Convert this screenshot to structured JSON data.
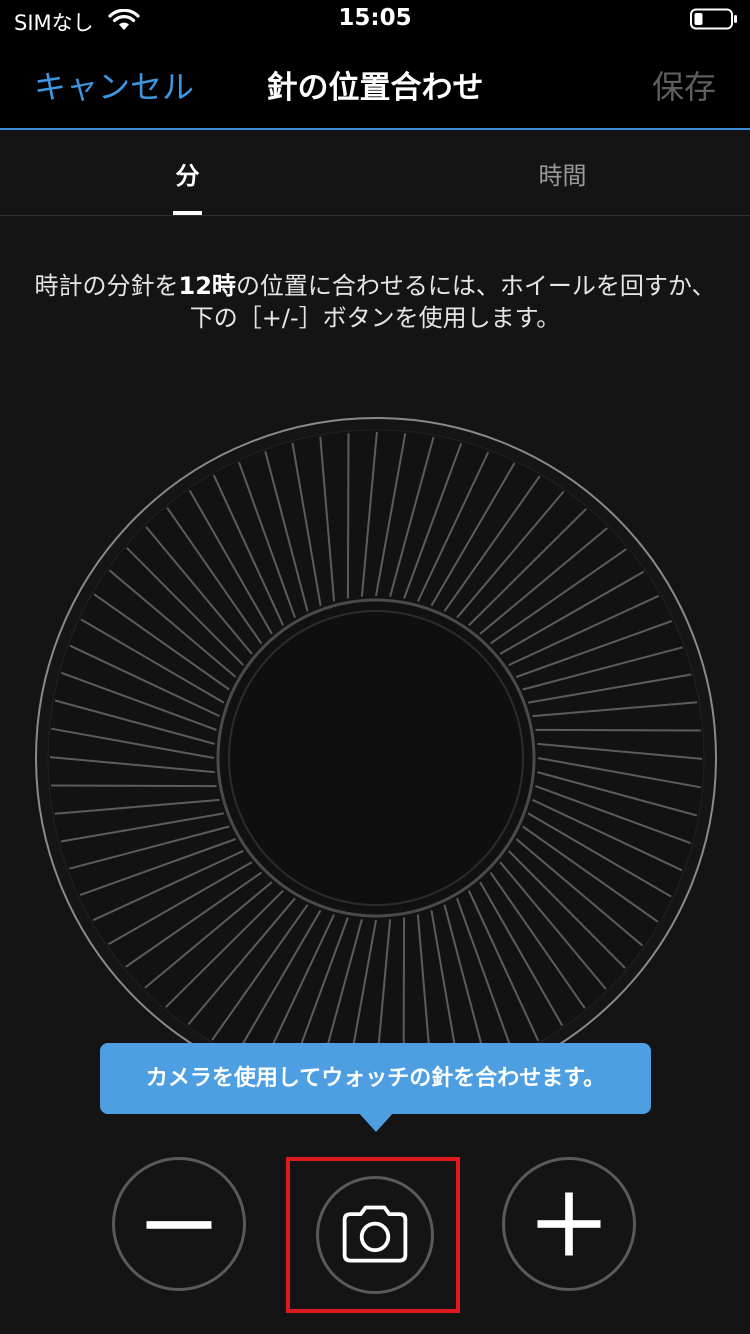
{
  "status_bar": {
    "carrier": "SIMなし",
    "time": "15:05"
  },
  "nav": {
    "cancel_label": "キャンセル",
    "title": "針の位置合わせ",
    "save_label": "保存"
  },
  "tabs": [
    {
      "label": "分",
      "selected": true
    },
    {
      "label": "時間",
      "selected": false
    }
  ],
  "instruction": {
    "before": "時計の分針を",
    "bold": "12時",
    "after": "の位置に合わせるには、ホイールを回すか、下の［+/-］ボタンを使用します。"
  },
  "tooltip": {
    "text": "カメラを使用してウォッチの針を合わせます。"
  },
  "buttons": {
    "minus_icon": "minus-icon",
    "camera_icon": "camera-icon",
    "plus_icon": "plus-icon"
  },
  "colors": {
    "accent": "#3d97e0",
    "tooltip": "#4d9fe2",
    "highlight": "#e0181f",
    "disabled": "#5f5f5f"
  }
}
